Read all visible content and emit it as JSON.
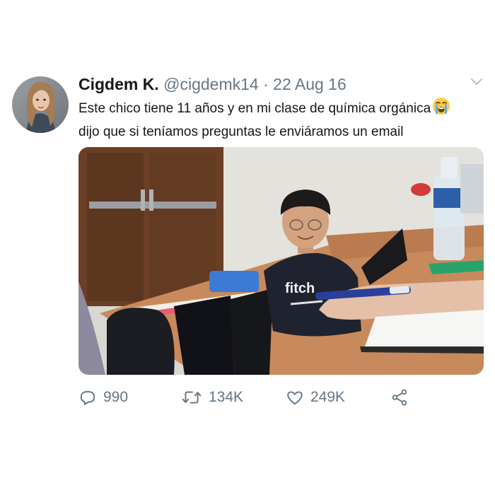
{
  "tweet": {
    "author_name": "Cigdem K.",
    "author_handle": "@cigdemk14",
    "separator": "·",
    "date": "22 Aug 16",
    "text_line1": "Este chico tiene 11 años y en mi clase de química orgánica",
    "text_line2": "dijo que si teníamos preguntas le enviáramos un email",
    "emoji": "crying-face-icon",
    "shirt_text": "fitch"
  },
  "actions": {
    "reply_count": "990",
    "retweet_count": "134K",
    "like_count": "249K"
  },
  "colors": {
    "text": "#14171a",
    "secondary": "#657786",
    "background": "#ffffff"
  }
}
